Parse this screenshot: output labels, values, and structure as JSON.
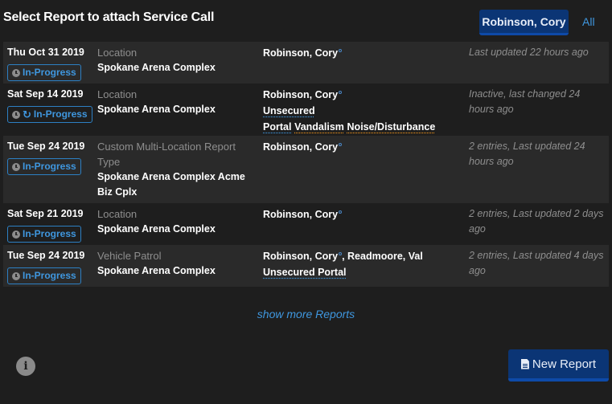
{
  "title": "Select Report to attach Service Call",
  "filters": {
    "active": "Robinson, Cory",
    "all": "All"
  },
  "reports": [
    {
      "date": "Thu Oct 31 2019",
      "status_badge": "In-Progress",
      "recurring": false,
      "type": "Location",
      "location": "Spokane Arena Complex",
      "people": "Robinson, Cory",
      "people_extra": "",
      "tags": [],
      "status_text": "Last updated 22 hours ago"
    },
    {
      "date": "Sat Sep 14 2019",
      "status_badge": "In-Progress",
      "recurring": true,
      "type": "Location",
      "location": "Spokane Arena Complex",
      "people": "Robinson, Cory",
      "people_extra": "",
      "tags": [
        {
          "label": "Unsecured",
          "color": "blue",
          "newline": false
        },
        {
          "label": "Portal",
          "color": "blue",
          "newline": true
        },
        {
          "label": "Vandalism",
          "color": "orange",
          "newline": false
        },
        {
          "label": "Noise/Disturbance",
          "color": "orange",
          "newline": false
        }
      ],
      "status_text": "Inactive, last changed 24 hours ago"
    },
    {
      "date": "Tue Sep 24 2019",
      "status_badge": "In-Progress",
      "recurring": false,
      "type": "Custom Multi-Location Report Type",
      "location": "Spokane Arena Complex Acme Biz Cplx",
      "people": "Robinson, Cory",
      "people_extra": "",
      "tags": [],
      "status_text": "2 entries, Last updated 24 hours ago"
    },
    {
      "date": "Sat Sep 21 2019",
      "status_badge": "In-Progress",
      "recurring": false,
      "type": "Location",
      "location": "Spokane Arena Complex",
      "people": "Robinson, Cory",
      "people_extra": "",
      "tags": [],
      "status_text": "2 entries, Last updated 2 days ago"
    },
    {
      "date": "Tue Sep 24 2019",
      "status_badge": "In-Progress",
      "recurring": false,
      "type": "Vehicle Patrol",
      "location": "Spokane Arena Complex",
      "people": "Robinson, Cory",
      "people_extra": ", Readmoore, Val",
      "tags": [
        {
          "label": "Unsecured Portal",
          "color": "blue",
          "newline": false
        }
      ],
      "status_text": "2 entries, Last updated 4 days ago"
    }
  ],
  "show_more": "show more Reports",
  "new_report": "New Report",
  "icons": {
    "info": "info-icon",
    "clock": "clock-icon",
    "repeat": "repeat-icon",
    "document": "document-icon"
  }
}
